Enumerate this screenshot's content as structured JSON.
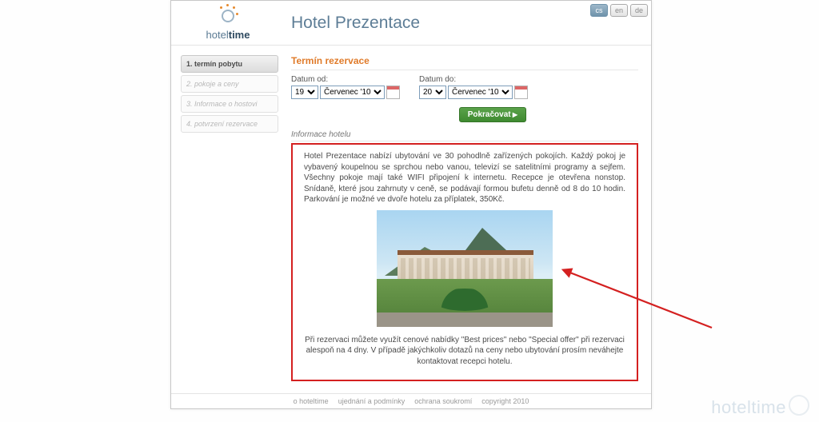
{
  "lang": {
    "cs": "cs",
    "en": "en",
    "de": "de",
    "active": "cs"
  },
  "brand": {
    "name_a": "hotel",
    "name_b": "time"
  },
  "title": "Hotel Prezentace",
  "steps": [
    {
      "label": "1. termín pobytu",
      "active": true
    },
    {
      "label": "2. pokoje a ceny",
      "active": false
    },
    {
      "label": "3. Informace o hostovi",
      "active": false
    },
    {
      "label": "4. potvrzení rezervace",
      "active": false
    }
  ],
  "term": {
    "heading": "Termín rezervace",
    "from_label": "Datum od:",
    "to_label": "Datum do:",
    "from_day": "19",
    "to_day": "20",
    "month": "Červenec '10",
    "continue": "Pokračovat"
  },
  "info": {
    "heading": "Informace hotelu",
    "p1": "Hotel Prezentace nabízí ubytování ve 30 pohodlně zařízených pokojích. Každý pokoj je vybavený koupelnou se sprchou nebo vanou, televizí se satelitními programy a sejfem. Všechny pokoje mají také WIFI připojení k internetu. Recepce je otevřena nonstop. Snídaně, které jsou zahrnuty v ceně, se podávají formou bufetu denně od 8 do 10 hodin. Parkování je možné ve dvoře hotelu za příplatek, 350Kč.",
    "p2": "Při rezervaci můžete využít cenové nabídky \"Best prices\" nebo \"Special offer\" při rezervaci alespoň na 4 dny. V případě jakýchkoliv dotazů na ceny nebo ubytování prosím neváhejte kontaktovat recepci hotelu."
  },
  "footer": {
    "about": "o hoteltime",
    "terms": "ujednání a podmínky",
    "privacy": "ochrana soukromí",
    "copyright": "copyright 2010"
  },
  "watermark": "hoteltime"
}
